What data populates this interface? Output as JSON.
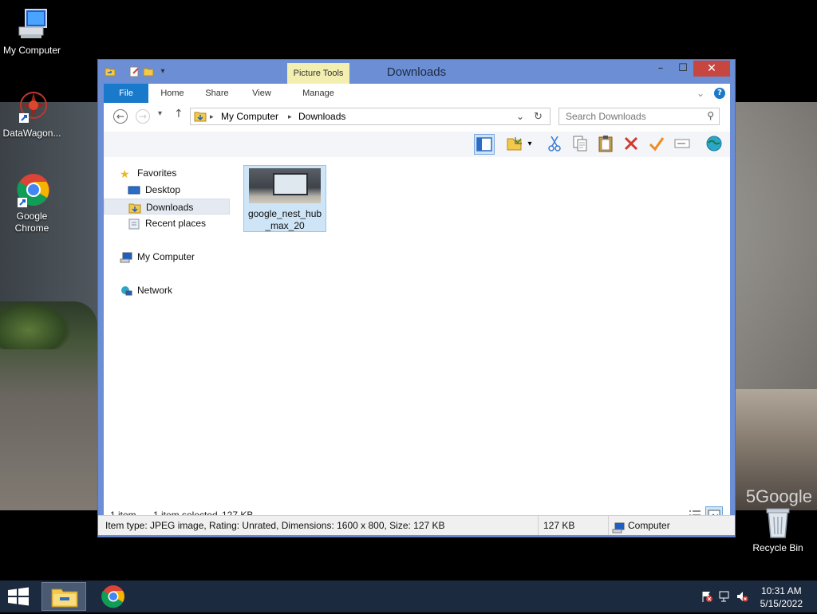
{
  "desktop": {
    "icons": [
      {
        "label": "My Computer"
      },
      {
        "label": "DataWagon..."
      },
      {
        "label": "Google Chrome"
      },
      {
        "label": "Recycle Bin"
      }
    ],
    "watermark": "5Google"
  },
  "window": {
    "title": "Downloads",
    "context_tab": "Picture Tools",
    "ribbon_tabs": [
      "File",
      "Home",
      "Share",
      "View",
      "Manage"
    ],
    "help_icon": "?",
    "controls": {
      "minimize": "–",
      "maximize": "☐",
      "close": "✕"
    }
  },
  "address": {
    "segments": [
      "My Computer",
      "Downloads"
    ],
    "search_placeholder": "Search Downloads"
  },
  "toolbar": {
    "icons": [
      "preview-pane-icon",
      "properties-icon",
      "cut-icon",
      "copy-icon",
      "paste-icon",
      "delete-icon",
      "select-icon",
      "rename-icon",
      "globe-icon"
    ]
  },
  "navpane": {
    "favorites": "Favorites",
    "items": [
      "Desktop",
      "Downloads",
      "Recent places"
    ],
    "my_computer": "My Computer",
    "network": "Network"
  },
  "files": [
    {
      "name_line1": "google_nest_hub",
      "name_line2": "_max_20"
    }
  ],
  "status": {
    "count": "1 item",
    "selected": "1 item selected",
    "size": "127 KB"
  },
  "details": {
    "info": "Item type: JPEG image, Rating: Unrated, Dimensions: 1600 x 800, Size: 127 KB",
    "size": "127 KB",
    "location": "Computer"
  },
  "taskbar": {
    "time": "10:31 AM",
    "date": "5/15/2022"
  },
  "colors": {
    "window_frame": "#6c8ed4",
    "file_tab": "#1979ca",
    "taskbar": "#1c2a3f",
    "selection": "#cde5f7"
  }
}
